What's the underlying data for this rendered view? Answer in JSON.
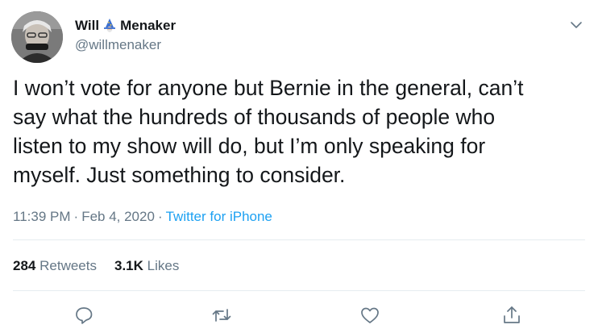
{
  "author": {
    "name_first": "Will",
    "name_last": "Menaker",
    "handle": "@willmenaker",
    "badge_icon": "wizard-emoji-icon"
  },
  "tweet": {
    "text": "I won’t vote for anyone but Bernie in the general, can’t\nsay what the hundreds of thousands of people who\nlisten to my show will do, but I’m  only speaking for\nmyself. Just something to consider.",
    "time": "11:39 PM",
    "date": "Feb 4, 2020",
    "separator": "·",
    "source": "Twitter for iPhone"
  },
  "stats": {
    "retweets_count": "284",
    "retweets_label": "Retweets",
    "likes_count": "3.1K",
    "likes_label": "Likes"
  },
  "actions": [
    "reply-icon",
    "retweet-icon",
    "like-icon",
    "share-icon"
  ],
  "colors": {
    "text": "#14171a",
    "secondary": "#657786",
    "link": "#1da1f2",
    "divider": "#e6ecf0"
  }
}
